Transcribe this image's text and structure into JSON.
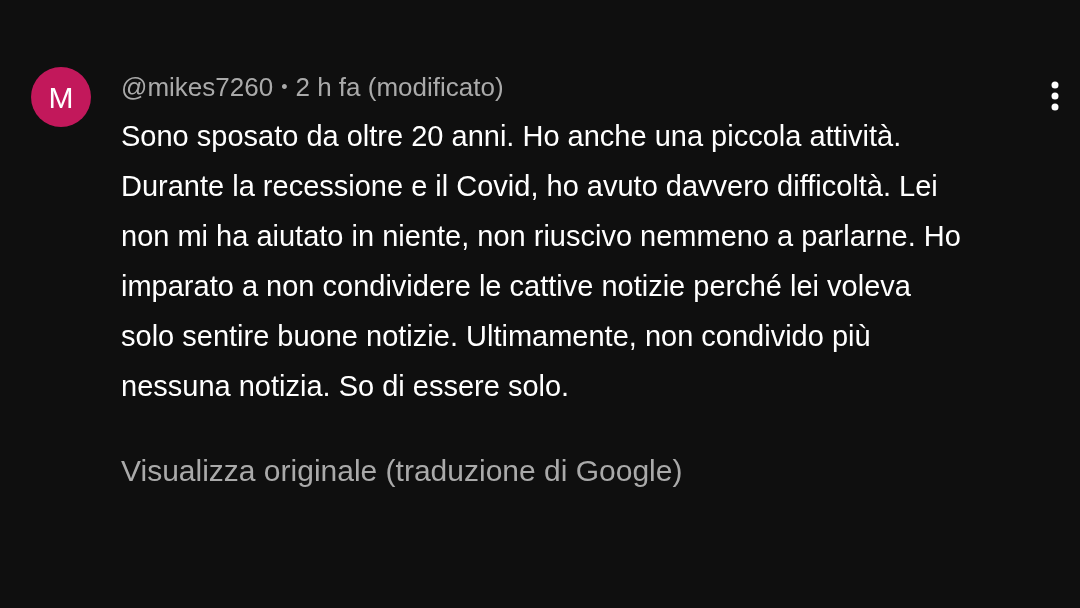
{
  "comment": {
    "avatar": {
      "letter": "M",
      "color": "#c2185b"
    },
    "author": "@mikes7260",
    "separator": "•",
    "time": "2 h fa (modificato)",
    "text": "Sono sposato da oltre 20 anni. Ho anche una piccola attività. Durante la recessione e il Covid, ho avuto davvero difficoltà. Lei non mi ha aiutato in niente, non riuscivo nemmeno a parlarne. Ho imparato a non condividere le cattive notizie perché lei voleva solo sentire buone notizie. Ultimamente, non condivido più nessuna notizia. So di essere solo.",
    "translation_link": "Visualizza originale (traduzione di Google)"
  }
}
